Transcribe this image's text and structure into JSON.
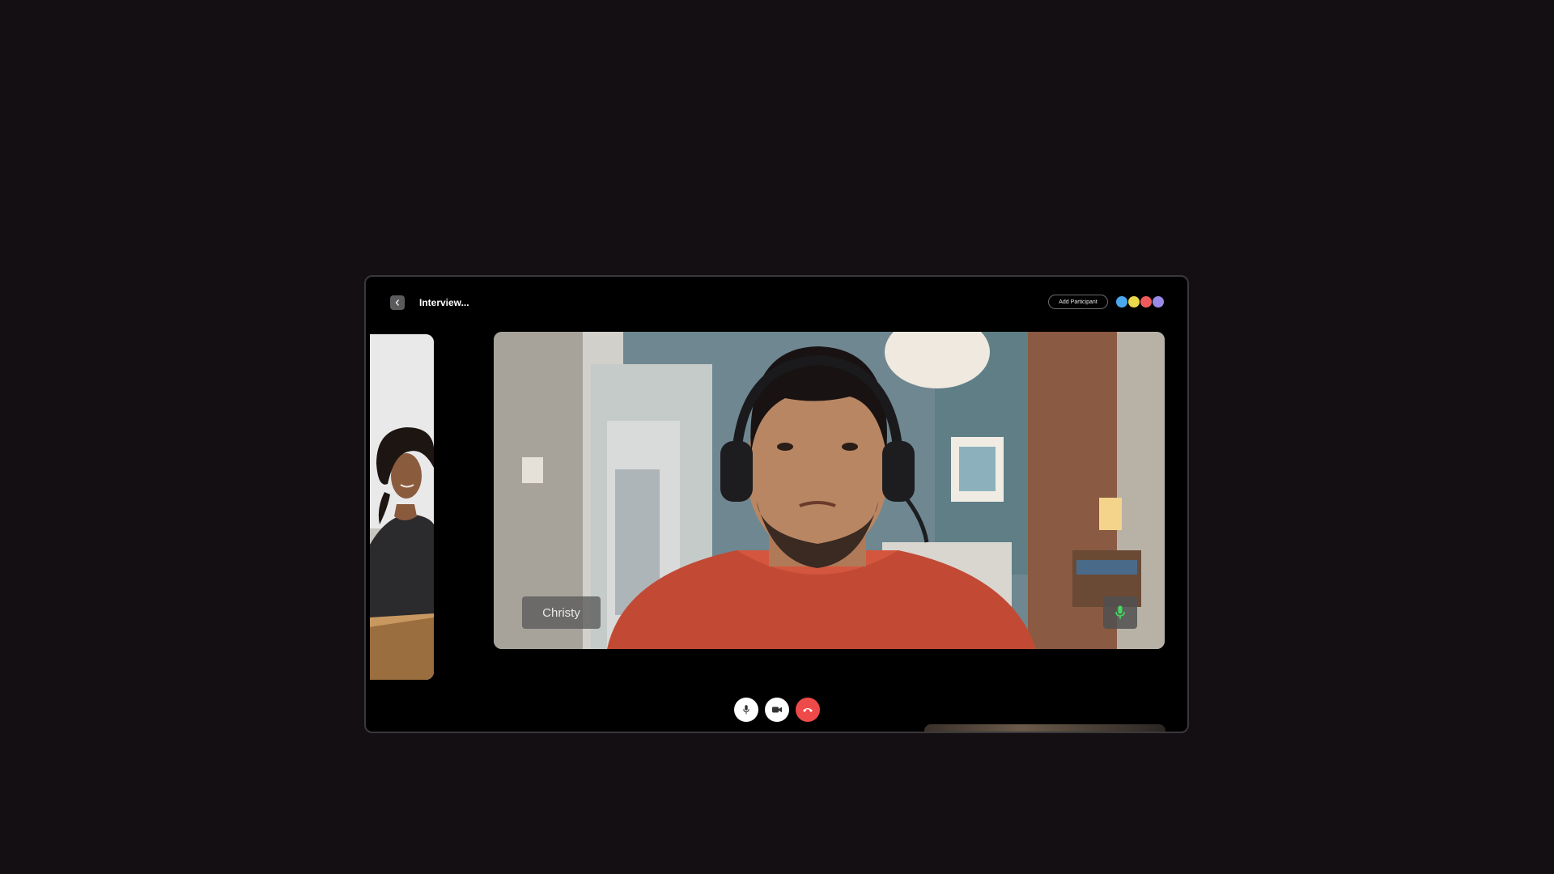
{
  "header": {
    "title": "Interview...",
    "add_participant_label": "Add Participant",
    "participants": [
      {
        "initial": "",
        "color": "#4aa8ef"
      },
      {
        "initial": "",
        "color": "#e8d84a"
      },
      {
        "initial": "",
        "color": "#ef5a5a"
      },
      {
        "initial": "",
        "color": "#9a8ae8"
      }
    ]
  },
  "main_video": {
    "speaker_name": "Christy",
    "mic_active_color": "#3ddc5a"
  },
  "controls": {
    "mic": "microphone-icon",
    "video": "video-camera-icon",
    "end": "phone-hangup-icon",
    "end_color": "#ef4a4a"
  }
}
